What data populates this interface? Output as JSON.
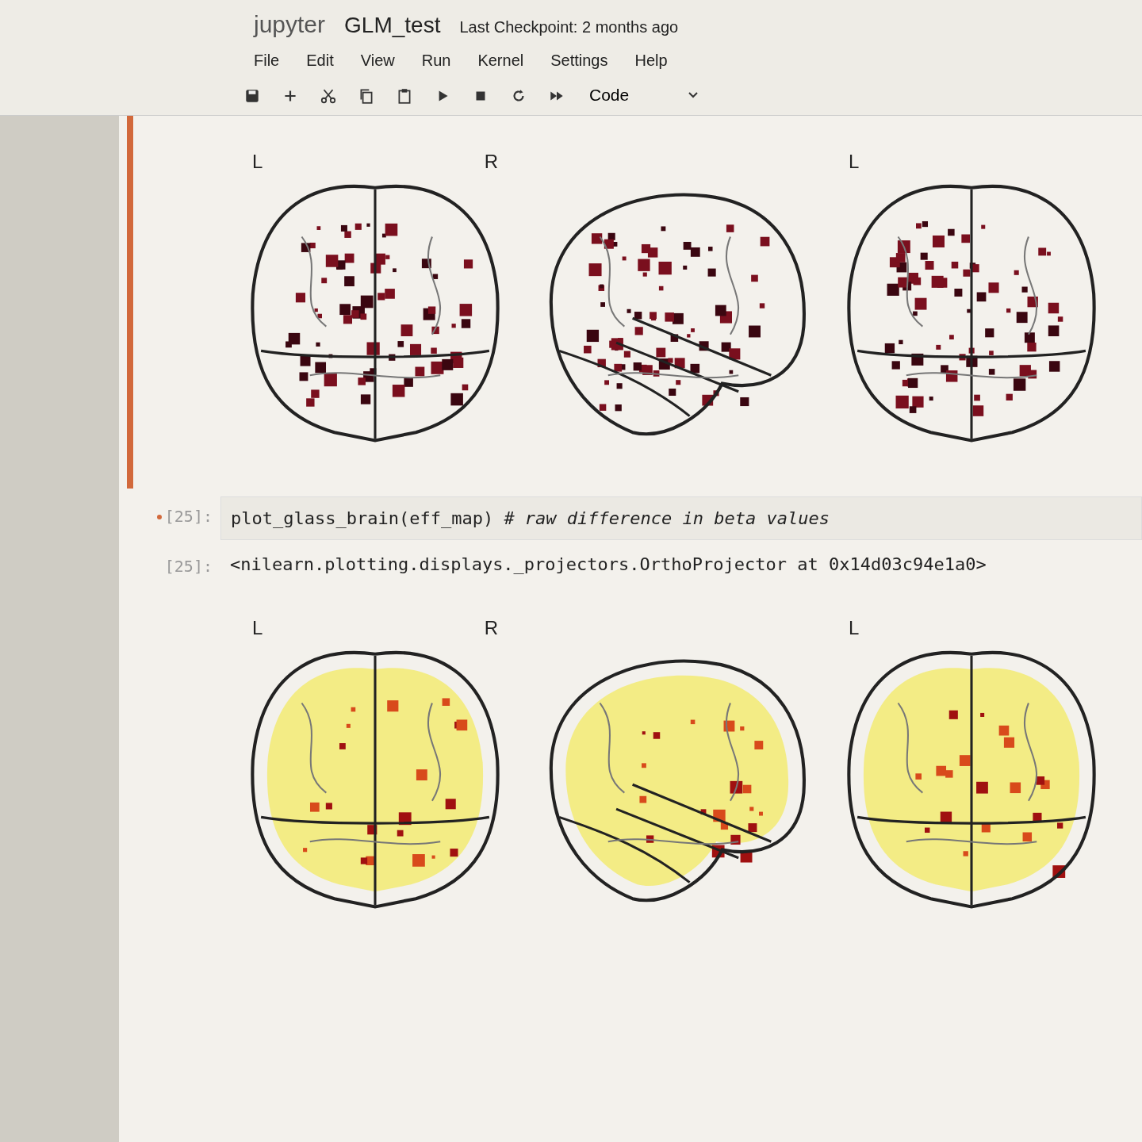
{
  "header": {
    "logo": "jupyter",
    "title": "GLM_test",
    "checkpoint": "Last Checkpoint: 2 months ago"
  },
  "menu": [
    "File",
    "Edit",
    "View",
    "Run",
    "Kernel",
    "Settings",
    "Help"
  ],
  "toolbar": {
    "cell_type": "Code"
  },
  "cells": [
    {
      "kind": "sparse",
      "selected": true,
      "views": [
        {
          "kind": "top",
          "left_label": "L",
          "right_label": "R"
        },
        {
          "kind": "side"
        },
        {
          "kind": "top",
          "left_label": "L"
        }
      ]
    },
    {
      "kind": "code",
      "selected": false,
      "dirty": true,
      "prompt": "[25]:",
      "code": "plot_glass_brain(eff_map) *# raw difference in beta values*"
    },
    {
      "kind": "text",
      "selected": false,
      "prompt": "[25]:",
      "text": "<nilearn.plotting.displays._projectors.OrthoProjector at 0x14d03c94e1a0>"
    },
    {
      "kind": "diffuse",
      "selected": false,
      "views": [
        {
          "kind": "top",
          "left_label": "L",
          "right_label": "R"
        },
        {
          "kind": "side"
        },
        {
          "kind": "top",
          "left_label": "L"
        }
      ]
    }
  ]
}
